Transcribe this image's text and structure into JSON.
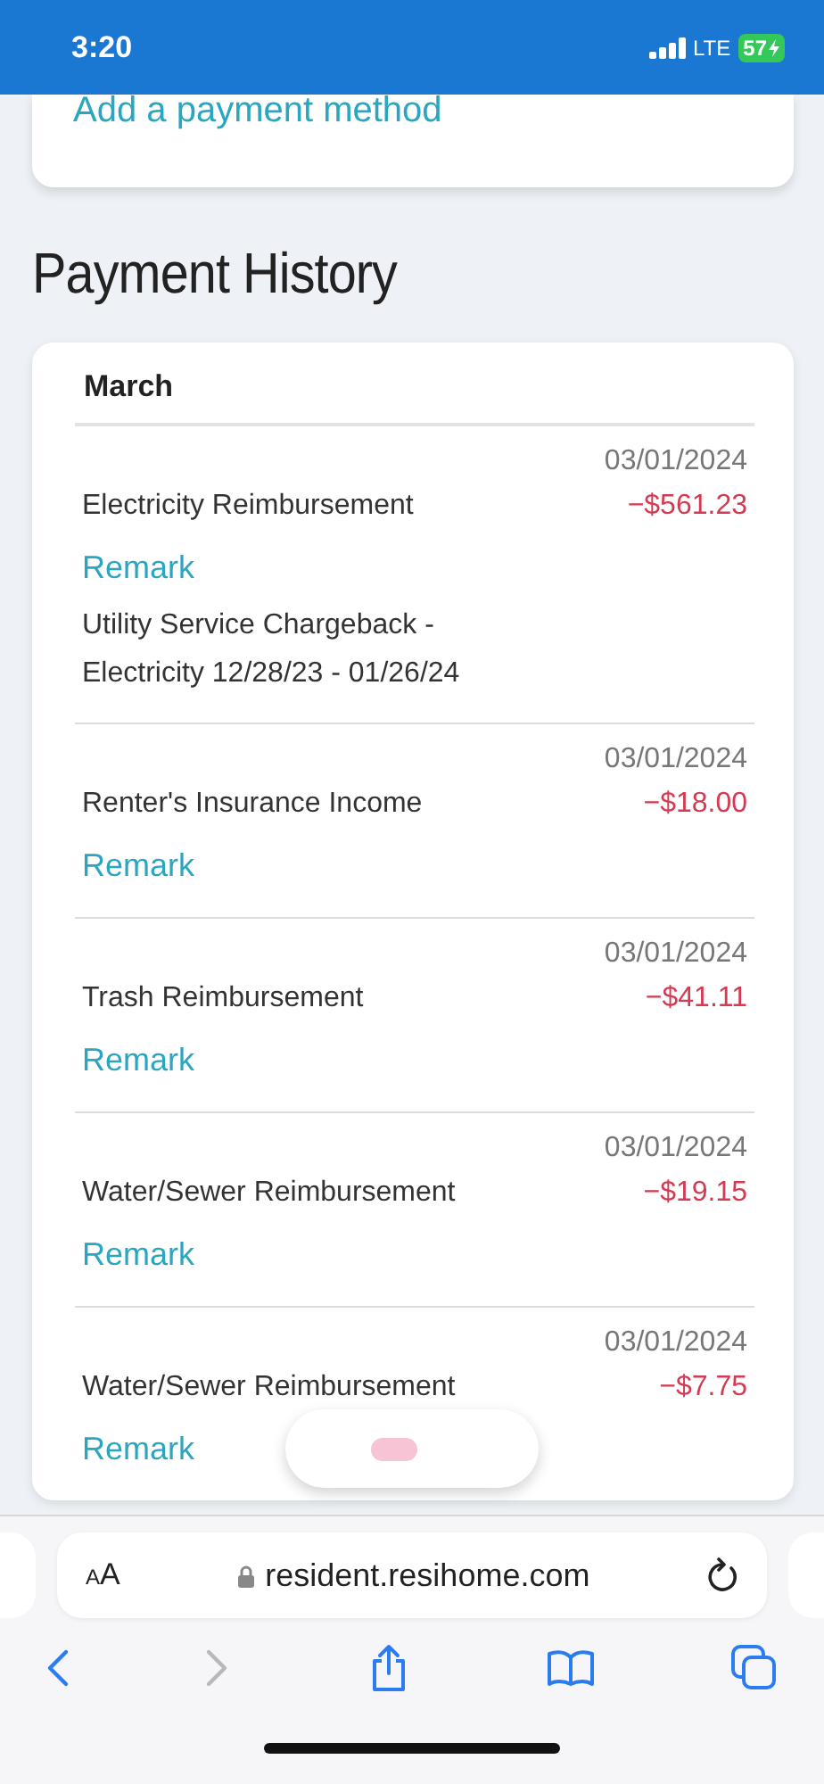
{
  "status_bar": {
    "time": "3:20",
    "network": "LTE",
    "battery": "57"
  },
  "payment_card": {
    "link": "Add a payment method"
  },
  "heading": "Payment History",
  "history": {
    "month": "March",
    "transactions": [
      {
        "date": "03/01/2024",
        "title": "Electricity Reimbursement",
        "amount": "−$561.23",
        "remark": "Remark",
        "note": "Utility Service Chargeback - Electricity 12/28/23 - 01/26/24"
      },
      {
        "date": "03/01/2024",
        "title": "Renter's Insurance Income",
        "amount": "−$18.00",
        "remark": "Remark"
      },
      {
        "date": "03/01/2024",
        "title": "Trash Reimbursement",
        "amount": "−$41.11",
        "remark": "Remark"
      },
      {
        "date": "03/01/2024",
        "title": "Water/Sewer Reimbursement",
        "amount": "−$19.15",
        "remark": "Remark"
      },
      {
        "date": "03/01/2024",
        "title": "Water/Sewer Reimbursement",
        "amount": "−$7.75",
        "remark": "Remark"
      }
    ]
  },
  "browser": {
    "text_size": "AA",
    "url": "resident.resihome.com"
  }
}
